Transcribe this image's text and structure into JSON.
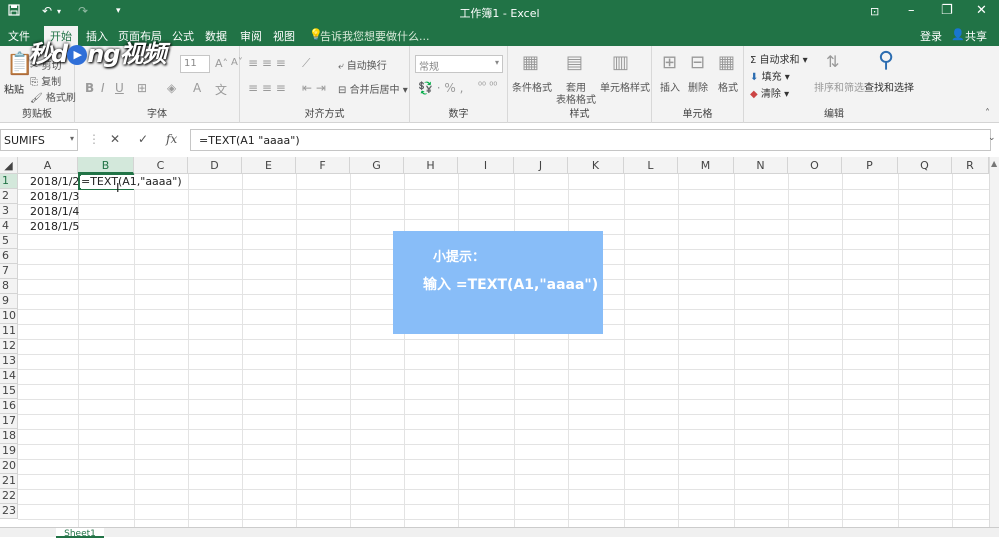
{
  "titlebar": {
    "title": "工作簿1 - Excel",
    "save_icon": "save-icon",
    "undo_icon": "undo-icon",
    "redo_icon": "redo-icon",
    "ribbon_display_icon": "ribbon-display-icon",
    "minimize": "–",
    "restore": "❐",
    "close": "✕"
  },
  "menu": {
    "items": [
      "文件",
      "开始",
      "插入",
      "页面布局",
      "公式",
      "数据",
      "审阅",
      "视图"
    ],
    "active_index": 1,
    "tellme": "告诉我您想要做什么...",
    "login": "登录",
    "share": "共享"
  },
  "watermark": {
    "pre": "秒d",
    "post": "ng视频"
  },
  "ribbon": {
    "clipboard": {
      "paste": "粘贴",
      "cut": "剪切",
      "copy": "复制",
      "format_painter": "格式刷",
      "label": "剪贴板"
    },
    "font": {
      "size": "11",
      "bold": "B",
      "italic": "I",
      "underline": "U",
      "label": "字体"
    },
    "align": {
      "wrap": "自动换行",
      "merge": "合并后居中",
      "label": "对齐方式"
    },
    "number": {
      "format": "常规",
      "label": "数字"
    },
    "styles": {
      "cond": "条件格式",
      "table_1": "套用",
      "table_2": "表格格式",
      "cell_styles": "单元格样式",
      "label": "样式"
    },
    "cells": {
      "insert": "插入",
      "delete": "删除",
      "format": "格式",
      "label": "单元格"
    },
    "editing": {
      "autosum": "自动求和",
      "fill": "填充",
      "clear": "清除",
      "sort": "排序和筛选",
      "find": "查找和选择",
      "label": "编辑"
    }
  },
  "formula_bar": {
    "name_box": "SUMIFS",
    "cancel": "✕",
    "enter": "✓",
    "fx": "fx",
    "formula": "=TEXT(A1 \"aaaa\")"
  },
  "grid": {
    "columns": [
      "A",
      "B",
      "C",
      "D",
      "E",
      "F",
      "G",
      "H",
      "I",
      "J",
      "K",
      "L",
      "M",
      "N",
      "O",
      "P",
      "Q",
      "R"
    ],
    "rows": [
      "1",
      "2",
      "3",
      "4",
      "5",
      "6",
      "7",
      "8",
      "9",
      "10",
      "11",
      "12",
      "13",
      "14",
      "15",
      "16",
      "17",
      "18",
      "19",
      "20",
      "21",
      "22",
      "23"
    ],
    "cells": {
      "A1": "2018/1/2",
      "A2": "2018/1/3",
      "A3": "2018/1/4",
      "A4": "2018/1/5",
      "B1": "=TEXT(A1,\"aaaa\")"
    }
  },
  "tip": {
    "line1": "小提示：",
    "line2": "输入 =TEXT(A1,\"aaaa\")"
  },
  "sheet_tab": "Sheet1"
}
